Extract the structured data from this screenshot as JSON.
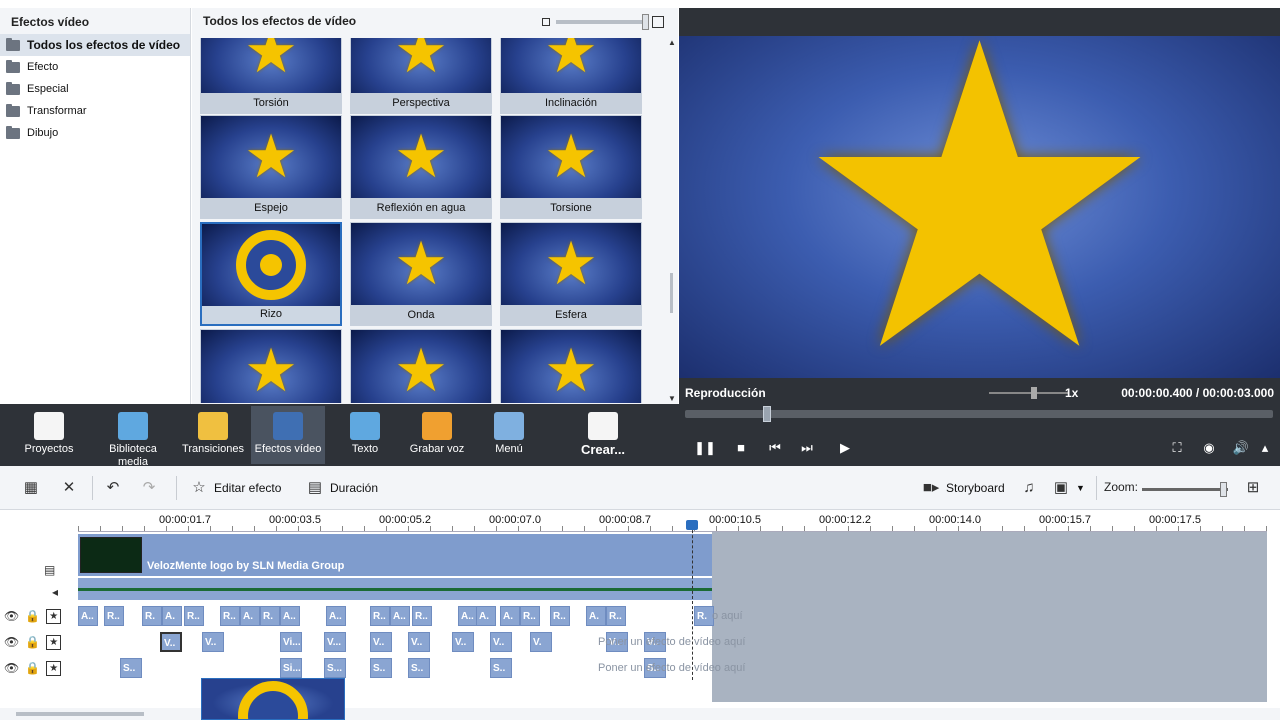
{
  "categories": {
    "header": "Efectos vídeo",
    "items": [
      {
        "label": "Todos los efectos de vídeo",
        "selected": true
      },
      {
        "label": "Efecto"
      },
      {
        "label": "Especial"
      },
      {
        "label": "Transformar"
      },
      {
        "label": "Dibujo"
      }
    ]
  },
  "grid": {
    "header": "Todos los efectos de vídeo",
    "tiles": [
      {
        "label": "Torsión",
        "icon": "star"
      },
      {
        "label": "Perspectiva",
        "icon": "star"
      },
      {
        "label": "Inclinación",
        "icon": "star"
      },
      {
        "label": "Espejo",
        "icon": "star"
      },
      {
        "label": "Reflexión en agua",
        "icon": "star"
      },
      {
        "label": "Torsione",
        "icon": "star"
      },
      {
        "label": "Rizo",
        "icon": "ring",
        "selected": true
      },
      {
        "label": "Onda",
        "icon": "star"
      },
      {
        "label": "Esfera",
        "icon": "star"
      },
      {
        "label": "",
        "icon": "star"
      },
      {
        "label": "",
        "icon": "star"
      },
      {
        "label": "",
        "icon": "star"
      }
    ]
  },
  "preview": {
    "title": "Reproducción",
    "speed": "1x",
    "time": "00:00:00.400 / 00:00:03.000",
    "scrub_fraction": 0.133
  },
  "toolbar": {
    "items": [
      {
        "label": "Proyectos",
        "icon": "clapper-icon",
        "color": "#f5f5f5"
      },
      {
        "label": "Biblioteca media",
        "icon": "film-icon",
        "color": "#5fa8e0"
      },
      {
        "label": "Transiciones",
        "icon": "transition-icon",
        "color": "#f0c040"
      },
      {
        "label": "Efectos vídeo",
        "icon": "star-effect-icon",
        "color": "#3f6fb3",
        "selected": true
      },
      {
        "label": "Texto",
        "icon": "text-icon",
        "color": "#5fa8e0"
      },
      {
        "label": "Grabar voz",
        "icon": "microphone-icon",
        "color": "#f0a030"
      },
      {
        "label": "Menú",
        "icon": "menu-icon",
        "color": "#7fb0e0"
      },
      {
        "label": "Crear...",
        "icon": "create-icon",
        "color": "#f5f5f5"
      }
    ]
  },
  "editbar": {
    "edit_effect": "Editar efecto",
    "duration": "Duración",
    "storyboard": "Storyboard",
    "zoom": "Zoom:"
  },
  "timeline": {
    "ticks": [
      "00:00:01.7",
      "00:00:03.5",
      "00:00:05.2",
      "00:00:07.0",
      "00:00:08.7",
      "00:00:10.5",
      "00:00:12.2",
      "00:00:14.0",
      "00:00:15.7",
      "00:00:17.5"
    ],
    "video_label": "VelozMente logo by SLN Media Group",
    "hint_drop": "o aquí",
    "hint_effect": "Poner un efecto de vídeo aquí",
    "row1_clips": [
      "A..",
      "R..",
      "R.",
      "A.",
      "R..",
      "R..",
      "A.",
      "R.",
      "A..",
      "A..",
      "R..",
      "A..",
      "R..",
      "A..",
      "A.",
      "A.",
      "R..",
      "R..",
      "A.",
      "R..",
      "R."
    ],
    "row2_clips": [
      "V..",
      "V..",
      "Vi...",
      "V...",
      "V..",
      "V..",
      "V..",
      "V..",
      "V.",
      "V..",
      "V.."
    ],
    "row3_clips": [
      "S..",
      "Si...",
      "S...",
      "S..",
      "S..",
      "S..",
      "S.."
    ]
  }
}
